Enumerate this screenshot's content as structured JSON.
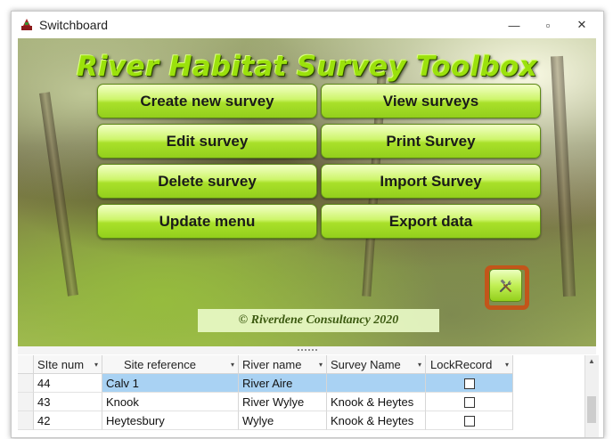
{
  "window": {
    "title": "Switchboard",
    "controls": {
      "minimize": "—",
      "restore": "▫",
      "close": "✕"
    }
  },
  "form": {
    "heading": "River Habitat Survey Toolbox",
    "buttons": {
      "create": "Create new survey",
      "view": "View surveys",
      "edit": "Edit  survey",
      "print": "Print Survey",
      "delete": "Delete survey",
      "import": "Import Survey",
      "update": "Update menu",
      "export": "Export data"
    },
    "tools_icon": "tools-icon",
    "copyright": "© Riverdene Consultancy 2020",
    "accent": "#a9e02a",
    "highlight_border": "#c2551a"
  },
  "grid": {
    "columns": [
      "SIte num",
      "Site reference",
      "River name",
      "Survey Name",
      "LockRecord"
    ],
    "rows": [
      {
        "site_num": "44",
        "site_ref": "Calv 1",
        "river": "River Aire",
        "survey": "",
        "locked": false
      },
      {
        "site_num": "43",
        "site_ref": "Knook",
        "river": "River Wylye",
        "survey": "Knook & Heytes",
        "locked": false
      },
      {
        "site_num": "42",
        "site_ref": "Heytesbury",
        "river": "Wylye",
        "survey": "Knook & Heytes",
        "locked": false
      }
    ],
    "selected_row_color": "#a9d2f3"
  }
}
